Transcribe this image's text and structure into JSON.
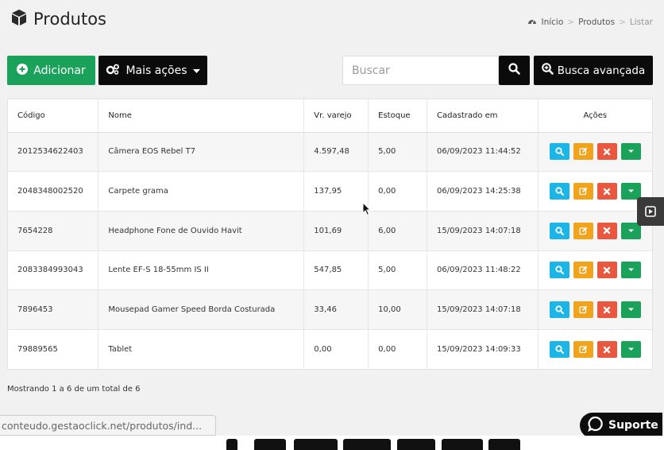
{
  "header": {
    "title": "Produtos",
    "breadcrumb": [
      "Início",
      "Produtos",
      "Listar"
    ],
    "breadcrumb_sep": ">"
  },
  "toolbar": {
    "add_label": "Adicionar",
    "more_label": "Mais ações",
    "search_placeholder": "Buscar",
    "advanced_label": "Busca avançada"
  },
  "table": {
    "columns": [
      "Código",
      "Nome",
      "Vr. varejo",
      "Estoque",
      "Cadastrado em",
      "Ações"
    ],
    "rows": [
      {
        "codigo": "2012534622403",
        "nome": "Câmera EOS Rebel T7",
        "valor": "4.597,48",
        "estoque": "5,00",
        "data": "06/09/2023 11:44:52"
      },
      {
        "codigo": "2048348002520",
        "nome": "Carpete grama",
        "valor": "137,95",
        "estoque": "0,00",
        "data": "06/09/2023 14:25:38"
      },
      {
        "codigo": "7654228",
        "nome": "Headphone Fone de Ouvido Havit",
        "valor": "101,69",
        "estoque": "6,00",
        "data": "15/09/2023 14:07:18"
      },
      {
        "codigo": "2083384993043",
        "nome": "Lente EF-S 18-55mm IS II",
        "valor": "547,85",
        "estoque": "5,00",
        "data": "06/09/2023 11:48:22"
      },
      {
        "codigo": "7896453",
        "nome": "Mousepad Gamer Speed Borda Costurada",
        "valor": "33,46",
        "estoque": "10,00",
        "data": "15/09/2023 14:07:18"
      },
      {
        "codigo": "79889565",
        "nome": "Tablet",
        "valor": "0,00",
        "estoque": "0,00",
        "data": "15/09/2023 14:09:33"
      }
    ]
  },
  "footer": {
    "info": "Mostrando 1 a 6 de um total de 6"
  },
  "status_url": "conteudo.gestaoclick.net/produtos/ind...",
  "support_label": "Suporte",
  "colors": {
    "green": "#1aa15a",
    "black": "#0b0b0b",
    "blue": "#1bb5e8",
    "orange": "#f0a31b",
    "red": "#e9573f"
  }
}
